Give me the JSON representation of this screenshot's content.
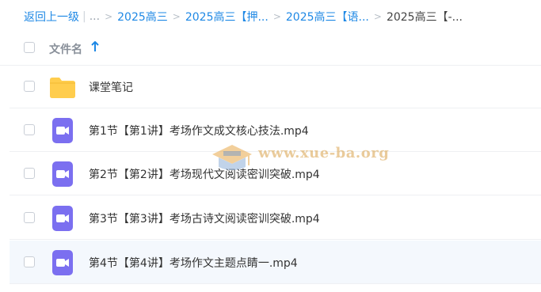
{
  "breadcrumb": {
    "back_label": "返回上一级",
    "bar": "|",
    "ellipsis": "...",
    "items": [
      {
        "label": "2025高三"
      },
      {
        "label": "2025高三【押..."
      },
      {
        "label": "2025高三【语..."
      }
    ],
    "current": "2025高三【-..."
  },
  "list_header": {
    "column_label": "文件名",
    "sort_direction": "ascending"
  },
  "files": [
    {
      "name": "课堂笔记",
      "type": "folder"
    },
    {
      "name": "第1节【第1讲】考场作文成文核心技法.mp4",
      "type": "video"
    },
    {
      "name": "第2节【第2讲】考场现代文阅读密训突破.mp4",
      "type": "video"
    },
    {
      "name": "第3节【第3讲】考场古诗文阅读密训突破.mp4",
      "type": "video"
    },
    {
      "name": "第4节【第4讲】考场作文主题点睛一.mp4",
      "type": "video",
      "selected": true
    }
  ],
  "watermark": {
    "text": "www.xue-ba.org"
  },
  "colors": {
    "link": "#1e88e5",
    "folder": "#ffcd4d",
    "video": "#7b6ff0",
    "selected_row": "#f4f8fd"
  }
}
